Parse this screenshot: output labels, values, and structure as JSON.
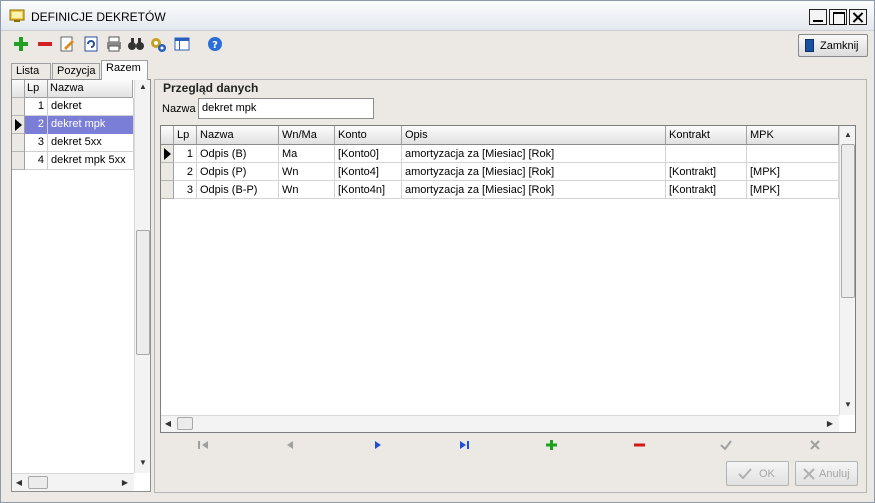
{
  "window": {
    "title": "DEFINICJE DEKRETÓW"
  },
  "toolbar": {
    "icons": [
      "add-icon",
      "delete-icon",
      "edit-icon",
      "refresh-icon",
      "print-icon",
      "find-icon",
      "settings-icon",
      "layout-icon",
      "help-icon"
    ],
    "close_label": "Zamknij"
  },
  "tabs": [
    {
      "label": "Lista"
    },
    {
      "label": "Pozycja"
    },
    {
      "label": "Razem"
    }
  ],
  "active_tab": "Razem",
  "left_grid": {
    "columns": [
      "Lp",
      "Nazwa"
    ],
    "rows": [
      {
        "lp": "1",
        "nazwa": "dekret"
      },
      {
        "lp": "2",
        "nazwa": "dekret mpk"
      },
      {
        "lp": "3",
        "nazwa": "dekret 5xx"
      },
      {
        "lp": "4",
        "nazwa": "dekret mpk 5xx"
      }
    ],
    "selected_index": 1
  },
  "overview": {
    "legend": "Przegląd danych",
    "name_label": "Nazwa",
    "name_value": "dekret mpk"
  },
  "main_grid": {
    "columns": [
      "Lp",
      "Nazwa",
      "Wn/Ma",
      "Konto",
      "Opis",
      "Kontrakt",
      "MPK"
    ],
    "rows": [
      [
        "1",
        "Odpis (B)",
        "Ma",
        "[Konto0]",
        "amortyzacja za [Miesiac] [Rok]",
        "",
        ""
      ],
      [
        "2",
        "Odpis (P)",
        "Wn",
        "[Konto4]",
        "amortyzacja za [Miesiac] [Rok]",
        "[Kontrakt]",
        "[MPK]"
      ],
      [
        "3",
        "Odpis (B-P)",
        "Wn",
        "[Konto4n]",
        "amortyzacja za [Miesiac] [Rok]",
        "[Kontrakt]",
        "[MPK]"
      ]
    ],
    "current_row": 0
  },
  "navigator": {
    "icons": [
      "first-icon",
      "prior-icon",
      "next-icon",
      "last-icon",
      "insert-icon",
      "delete-record-icon",
      "post-icon",
      "cancel-edit-icon"
    ],
    "colors": {
      "disabled": "#a0a0a0",
      "nav": "#1f4fd8",
      "insert": "#1aa31a",
      "delete": "#d21a1a"
    }
  },
  "buttons": {
    "ok": "OK",
    "cancel": "Anuluj"
  }
}
